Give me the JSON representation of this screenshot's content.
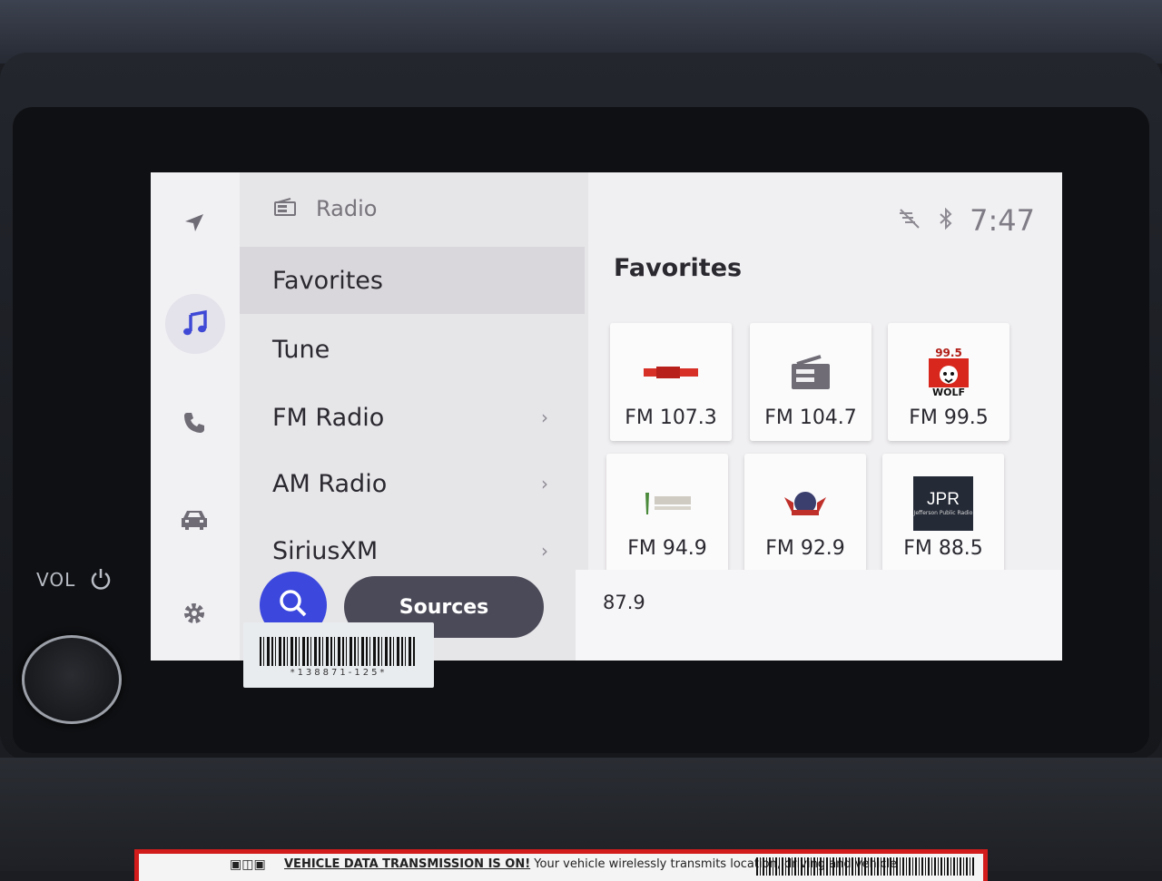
{
  "header": {
    "title": "Radio"
  },
  "status": {
    "time": "7:47"
  },
  "menu": {
    "items": [
      {
        "label": "Favorites",
        "chevron": ""
      },
      {
        "label": "Tune",
        "chevron": ""
      },
      {
        "label": "FM Radio",
        "chevron": "›"
      },
      {
        "label": "AM Radio",
        "chevron": "›"
      },
      {
        "label": "SiriusXM",
        "chevron": "›"
      }
    ],
    "sources_label": "Sources"
  },
  "favorites": {
    "title": "Favorites",
    "stations": [
      {
        "freq": "FM 107.3",
        "logo": "kzzy-logo"
      },
      {
        "freq": "FM 104.7",
        "logo": "generic-radio-icon"
      },
      {
        "freq": "FM 99.5",
        "logo": "the-wolf-logo",
        "logo_text_top": "99.5",
        "logo_text_bottom": "WOLF"
      },
      {
        "freq": "FM 94.9",
        "logo": "the-tee-logo"
      },
      {
        "freq": "FM 92.9",
        "logo": "station-crest-logo"
      },
      {
        "freq": "FM 88.5",
        "logo": "jpr-logo",
        "logo_text_top": "JPR",
        "logo_text_bottom": "Jefferson Public Radio"
      }
    ]
  },
  "now_playing": {
    "freq": "87.9"
  },
  "bezel": {
    "vol_label": "VOL"
  },
  "sticker": {
    "barcode_number": "*138871-125*"
  },
  "warning": {
    "bold_text": "VEHICLE DATA TRANSMISSION IS ON!",
    "text": "Your vehicle wirelessly transmits location, driving and vehicle"
  },
  "colors": {
    "accent": "#3b47dd",
    "sources_bg": "#4b4a58",
    "warning_border": "#d21c1c"
  }
}
